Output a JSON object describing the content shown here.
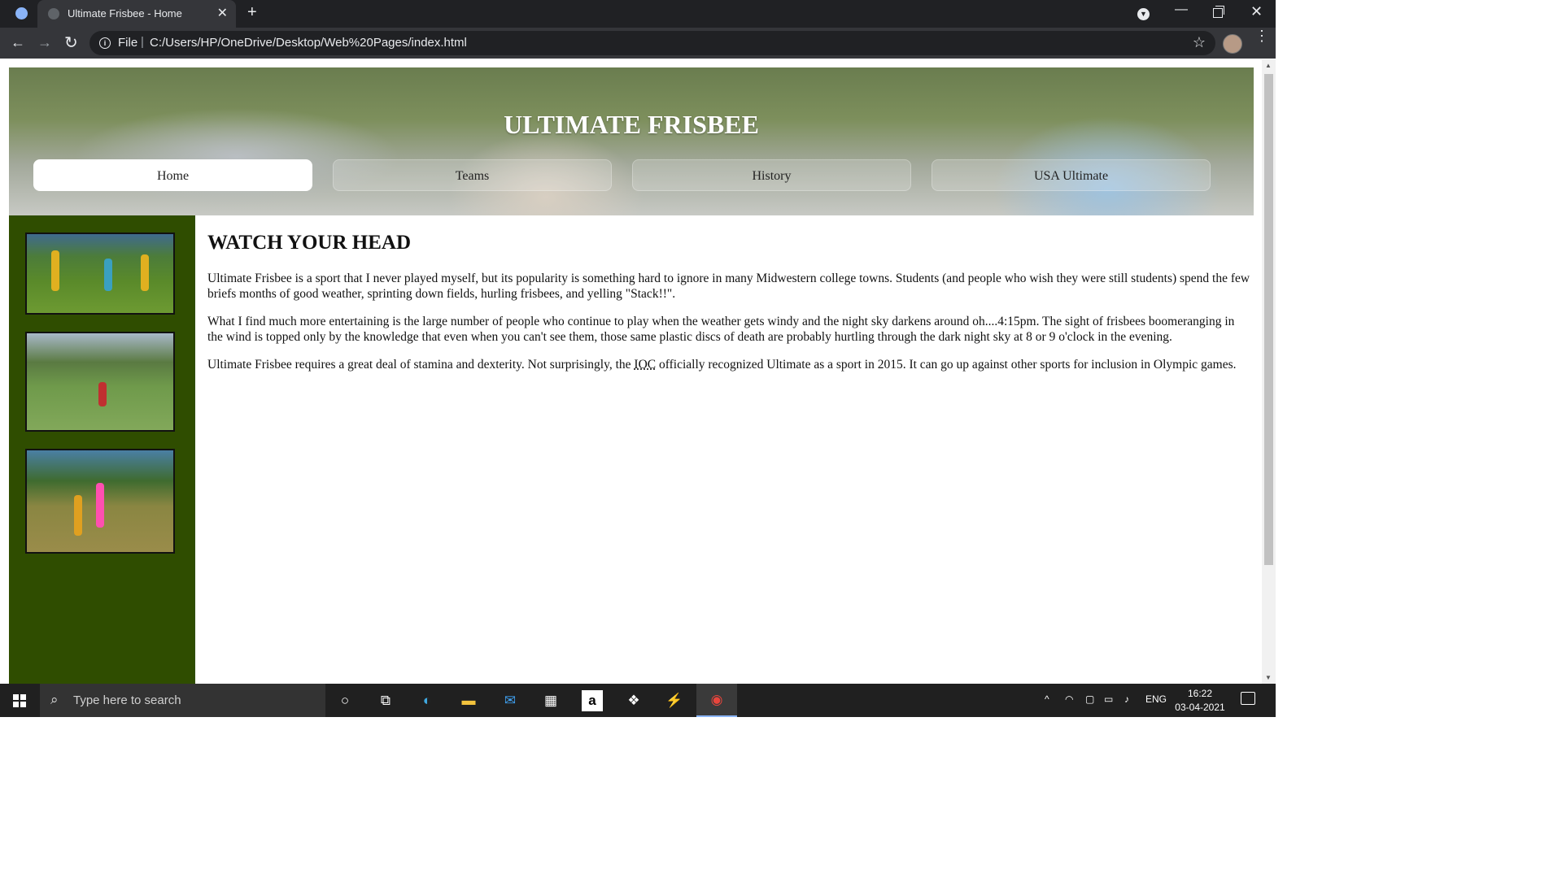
{
  "browser": {
    "tab_title": "Ultimate Frisbee - Home",
    "tab_close": "✕",
    "new_tab": "+",
    "url_scheme": "File",
    "url_separator": "|",
    "url_path": "C:/Users/HP/OneDrive/Desktop/Web%20Pages/index.html"
  },
  "site": {
    "title": "ULTIMATE FRISBEE",
    "nav": [
      {
        "label": "Home",
        "active": true
      },
      {
        "label": "Teams",
        "active": false
      },
      {
        "label": "History",
        "active": false
      },
      {
        "label": "USA Ultimate",
        "active": false
      }
    ],
    "sidebar_color": "#2f4d00"
  },
  "article": {
    "heading": "WATCH YOUR HEAD",
    "p1": "Ultimate Frisbee is a sport that I never played myself, but its popularity is something hard to ignore in many Midwestern college towns. Students (and people who wish they were still students) spend the few briefs months of good weather, sprinting down fields, hurling frisbees, and yelling \"Stack!!\".",
    "p2": "What I find much more entertaining is the large number of people who continue to play when the weather gets windy and the night sky darkens around oh....4:15pm. The sight of frisbees boomeranging in the wind is topped only by the knowledge that even when you can't see them, those same plastic discs of death are probably hurtling through the dark night sky at 8 or 9 o'clock in the evening.",
    "p3_before": "Ultimate Frisbee requires a great deal of stamina and dexterity. Not surprisingly, the ",
    "p3_abbr": "IOC",
    "p3_after": " officially recognized Ultimate as a sport in 2015. It can go up against other sports for inclusion in Olympic games."
  },
  "taskbar": {
    "search_placeholder": "Type here to search",
    "language": "ENG",
    "time": "16:22",
    "date": "03-04-2021"
  }
}
